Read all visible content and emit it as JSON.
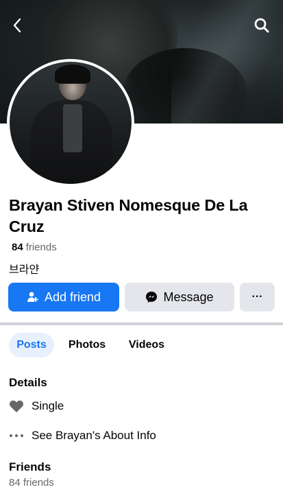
{
  "profile": {
    "name": "Brayan Stiven Nomesque De La Cruz",
    "friends_number": "84",
    "friends_word": "friends",
    "nickname": "브라얀"
  },
  "actions": {
    "add_friend": "Add friend",
    "message": "Message",
    "more": "···"
  },
  "tabs": [
    "Posts",
    "Photos",
    "Videos"
  ],
  "details": {
    "title": "Details",
    "relationship": "Single",
    "about_link": "See Brayan's About Info"
  },
  "friends_section": {
    "title": "Friends",
    "count_text": "84 friends"
  },
  "colors": {
    "accent": "#1877f2",
    "secondary_button": "#e4e6eb",
    "muted_text": "#65676b"
  },
  "icons": {
    "back": "chevron-left-icon",
    "search": "search-icon",
    "add_friend": "person-plus-icon",
    "message": "messenger-icon",
    "relationship": "heart-icon",
    "about": "more-dots-icon"
  }
}
